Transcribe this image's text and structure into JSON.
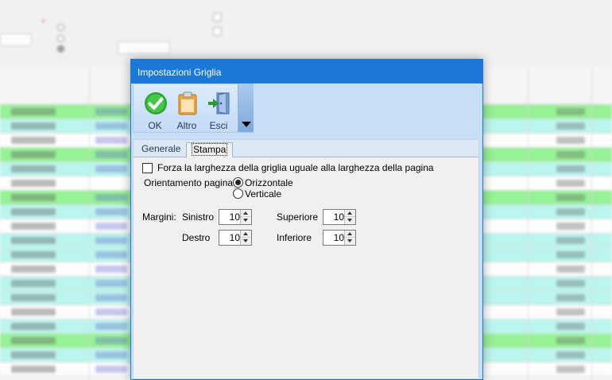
{
  "dialog": {
    "title": "Impostazioni Griglia",
    "toolbar": {
      "ok_label": "OK",
      "altro_label": "Altro",
      "esci_label": "Esci",
      "ok_icon": "check-icon",
      "altro_icon": "clipboard-icon",
      "esci_icon": "exit-door-icon",
      "overflow_icon": "chevron-down-icon"
    },
    "tabs": [
      {
        "label": "Generale",
        "active": false
      },
      {
        "label": "Stampa",
        "active": true
      }
    ],
    "stampa": {
      "fit_width_label": "Forza la larghezza della griglia uguale alla larghezza della pagina",
      "fit_width_checked": false,
      "orientation_label": "Orientamento pagina:",
      "orientation_options": [
        {
          "label": "Orizzontale",
          "selected": true
        },
        {
          "label": "Verticale",
          "selected": false
        }
      ],
      "margins_label": "Margini:",
      "margins": {
        "left_label": "Sinistro",
        "left_value": "10",
        "right_label": "Destro",
        "right_value": "10",
        "top_label": "Superiore",
        "top_value": "10",
        "bottom_label": "Inferiore",
        "bottom_value": "10"
      }
    }
  },
  "colors": {
    "title_bar": "#1a78d6",
    "row_green": "#8bf28b",
    "row_cyan": "#b5f7ee",
    "row_white": "#ffffff"
  }
}
